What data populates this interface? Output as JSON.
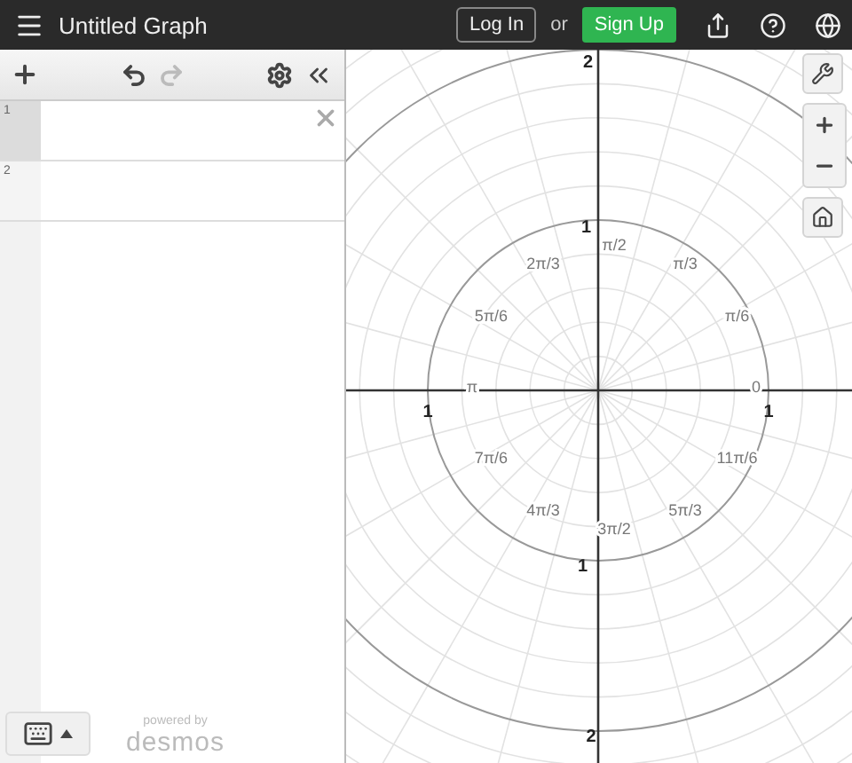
{
  "header": {
    "title": "Untitled Graph",
    "login": "Log In",
    "or": "or",
    "signup": "Sign Up"
  },
  "toolbar": {
    "undo_disabled": false,
    "redo_disabled": true
  },
  "expressions": [
    {
      "number": "1",
      "selected": true
    },
    {
      "number": "2",
      "selected": false
    }
  ],
  "footer": {
    "powered_by": "powered by",
    "brand": "desmos"
  },
  "graph": {
    "axis_labels": [
      "2",
      "1",
      "1",
      "1",
      "1",
      "2"
    ],
    "angle_labels": [
      "0",
      "π/6",
      "π/3",
      "π/2",
      "2π/3",
      "5π/6",
      "π",
      "7π/6",
      "4π/3",
      "3π/2",
      "5π/3",
      "11π/6"
    ]
  }
}
